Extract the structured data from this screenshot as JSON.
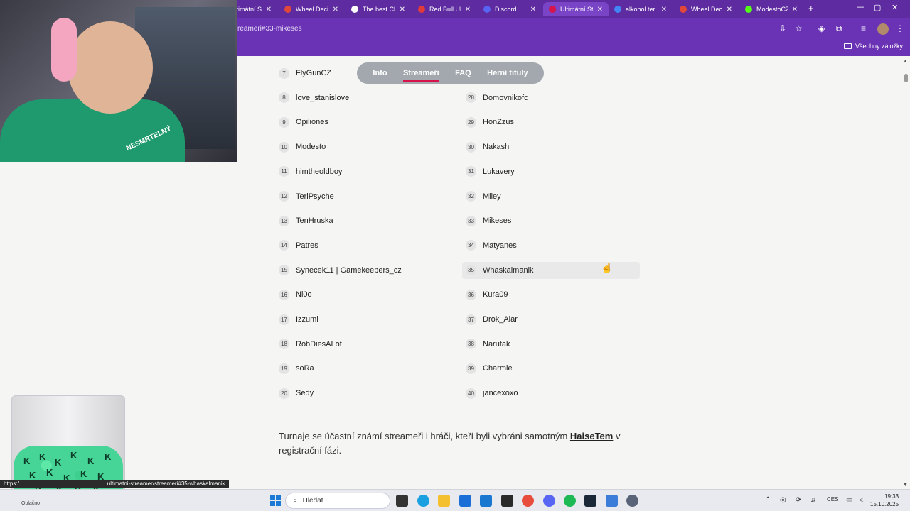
{
  "tabs": [
    {
      "title": "Ultimátní Str",
      "favicon_color": "#6a32b4",
      "active": false
    },
    {
      "title": "Wheel Decid",
      "favicon_color": "#e2483a",
      "active": false
    },
    {
      "title": "The best Ch",
      "favicon_color": "#ffffff",
      "active": false
    },
    {
      "title": "Red Bull Ulti",
      "favicon_color": "#e03a3a",
      "active": false
    },
    {
      "title": "Discord",
      "favicon_color": "#5865f2",
      "active": false
    },
    {
      "title": "Ultimátní Str",
      "favicon_color": "#d6134b",
      "active": true
    },
    {
      "title": "alkohol ter",
      "favicon_color": "#4285f4",
      "active": false
    },
    {
      "title": "Wheel Decid",
      "favicon_color": "#e2483a",
      "active": false
    },
    {
      "title": "ModestoCZ",
      "favicon_color": "#53fc18",
      "active": false
    }
  ],
  "address": {
    "url": "reameri#33-mikeses"
  },
  "bookmarks": {
    "label": "Všechny záložky"
  },
  "nav": {
    "items": [
      {
        "label": "Info",
        "active": false
      },
      {
        "label": "Streameři",
        "active": true
      },
      {
        "label": "FAQ",
        "active": false
      },
      {
        "label": "Herní tituly",
        "active": false
      }
    ],
    "accent_color": "#d6134b"
  },
  "left_column": [
    {
      "num": "7",
      "name": "FlyGunCZ"
    },
    {
      "num": "8",
      "name": "love_stanislove"
    },
    {
      "num": "9",
      "name": "Opiliones"
    },
    {
      "num": "10",
      "name": "Modesto"
    },
    {
      "num": "11",
      "name": "himtheoldboy"
    },
    {
      "num": "12",
      "name": "TeriPsyche"
    },
    {
      "num": "13",
      "name": "TenHruska"
    },
    {
      "num": "14",
      "name": "Patres"
    },
    {
      "num": "15",
      "name": "Synecek11 | Gamekeepers_cz"
    },
    {
      "num": "16",
      "name": "Ni0o"
    },
    {
      "num": "17",
      "name": "Izzumi"
    },
    {
      "num": "18",
      "name": "RobDiesALot"
    },
    {
      "num": "19",
      "name": "soRa"
    },
    {
      "num": "20",
      "name": "Sedy"
    }
  ],
  "right_column": [
    {
      "num": "28",
      "name": "Domovnikofc"
    },
    {
      "num": "29",
      "name": "HonZzus"
    },
    {
      "num": "30",
      "name": "Nakashi"
    },
    {
      "num": "31",
      "name": "Lukavery"
    },
    {
      "num": "32",
      "name": "Miley"
    },
    {
      "num": "33",
      "name": "Mikeses"
    },
    {
      "num": "34",
      "name": "Matyanes"
    },
    {
      "num": "35",
      "name": "Whaskalmanik",
      "highlighted": true
    },
    {
      "num": "36",
      "name": "Kura09"
    },
    {
      "num": "37",
      "name": "Drok_Alar"
    },
    {
      "num": "38",
      "name": "Narutak"
    },
    {
      "num": "39",
      "name": "Charmie"
    },
    {
      "num": "40",
      "name": "jancexoxo"
    }
  ],
  "paragraph": {
    "before": "Turnaje se účastní známí streameři i hráči, kteří byli vybráni samotným ",
    "link": "HaiseTem",
    "after": " v registrační fázi."
  },
  "status_link": "https://...ultimatni-streamer/streameri#35-whaskalmanik",
  "status_prefix": "https:/",
  "status_suffix": "ultimatni-streamer/streameri#35-whaskalmanik",
  "webcam": {
    "shirt_text": "NESMRTELNÝ"
  },
  "taskbar": {
    "search_placeholder": "Hledat",
    "weather_label": "Oblačno",
    "language": "CES",
    "time": "19:33",
    "date": "15.10.2025"
  }
}
